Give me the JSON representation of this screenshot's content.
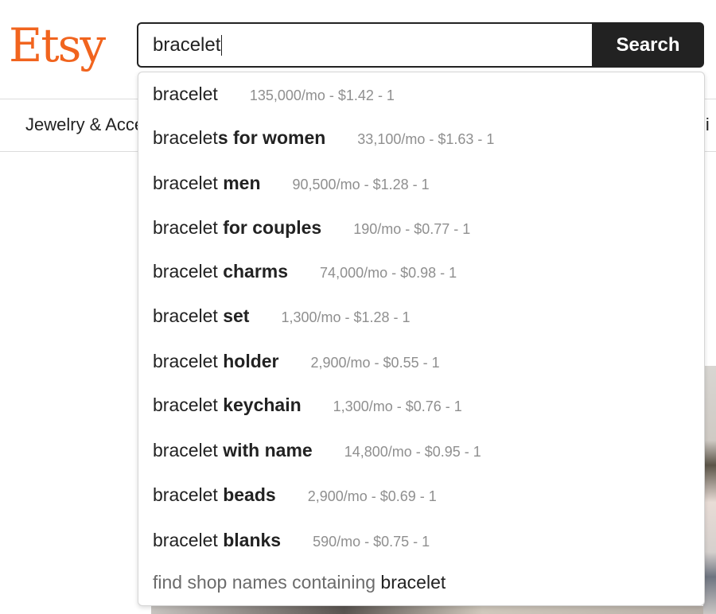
{
  "brand": {
    "logo_text": "Etsy",
    "accent_color": "#f1641e"
  },
  "search": {
    "query": "bracelet",
    "button_label": "Search"
  },
  "nav": {
    "left_item": "Jewelry & Accessories",
    "right_item_partial": "li"
  },
  "suggestions": [
    {
      "prefix": "bracelet",
      "suffix": "",
      "meta": "135,000/mo - $1.42 - 1"
    },
    {
      "prefix": "bracelet",
      "suffix": "s for women",
      "meta": "33,100/mo - $1.63 - 1"
    },
    {
      "prefix": "bracelet ",
      "suffix": "men",
      "meta": "90,500/mo - $1.28 - 1"
    },
    {
      "prefix": "bracelet ",
      "suffix": "for couples",
      "meta": "190/mo - $0.77 - 1"
    },
    {
      "prefix": "bracelet ",
      "suffix": "charms",
      "meta": "74,000/mo - $0.98 - 1"
    },
    {
      "prefix": "bracelet ",
      "suffix": "set",
      "meta": "1,300/mo - $1.28 - 1"
    },
    {
      "prefix": "bracelet ",
      "suffix": "holder",
      "meta": "2,900/mo - $0.55 - 1"
    },
    {
      "prefix": "bracelet ",
      "suffix": "keychain",
      "meta": "1,300/mo - $0.76 - 1"
    },
    {
      "prefix": "bracelet ",
      "suffix": "with name",
      "meta": "14,800/mo - $0.95 - 1"
    },
    {
      "prefix": "bracelet ",
      "suffix": "beads",
      "meta": "2,900/mo - $0.69 - 1"
    },
    {
      "prefix": "bracelet ",
      "suffix": "blanks",
      "meta": "590/mo - $0.75 - 1"
    }
  ],
  "shop_names": {
    "label": "find shop names containing ",
    "query": "bracelet"
  }
}
